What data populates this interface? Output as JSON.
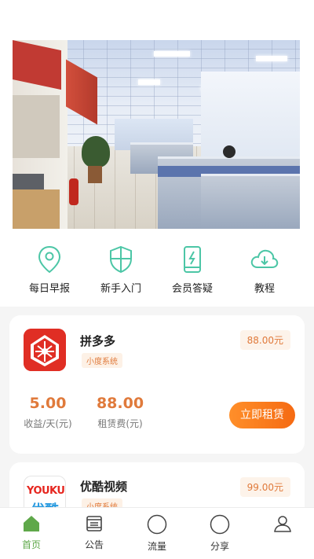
{
  "banner": {
    "alt_icon": "office-photo",
    "slides_count": 5,
    "active_slide": 1
  },
  "quick_links": [
    {
      "label": "每日早报",
      "icon": "location-pin-icon"
    },
    {
      "label": "新手入门",
      "icon": "shield-icon"
    },
    {
      "label": "会员答疑",
      "icon": "phone-bolt-icon"
    },
    {
      "label": "教程",
      "icon": "cloud-download-icon"
    }
  ],
  "products": [
    {
      "name": "拼多多",
      "tag": "小度系统",
      "price": "88.00元",
      "income_value": "5.00",
      "income_label": "收益/天(元)",
      "rent_value": "88.00",
      "rent_label": "租赁费(元)",
      "button_label": "立即租赁",
      "icon": "pinduoduo-logo"
    },
    {
      "name": "优酷视频",
      "tag": "小度系统",
      "price": "99.00元",
      "icon": "youku-logo",
      "logo_text": "YOUKU",
      "logo_sub": "优酷"
    }
  ],
  "tabbar": [
    {
      "label": "首页",
      "icon": "home-icon",
      "active": true
    },
    {
      "label": "公告",
      "icon": "notice-icon",
      "active": false
    },
    {
      "label": "流量",
      "icon": "circle-icon",
      "active": false
    },
    {
      "label": "分享",
      "icon": "circle-icon",
      "active": false
    },
    {
      "label": "",
      "icon": "user-icon",
      "active": false
    }
  ],
  "colors": {
    "accent_green": "#4cc6a6",
    "accent_orange": "#e07a3b",
    "tab_active": "#5fa84a"
  }
}
